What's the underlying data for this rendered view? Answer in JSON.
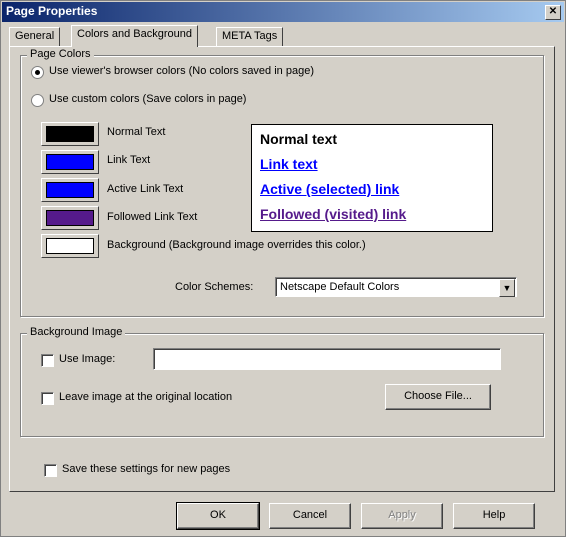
{
  "window": {
    "title": "Page Properties",
    "close_glyph": "✕"
  },
  "tabs": [
    {
      "label": "General"
    },
    {
      "label": "Colors and Background"
    },
    {
      "label": "META Tags"
    }
  ],
  "page_colors": {
    "legend": "Page Colors",
    "radio_browser": "Use viewer's browser colors (No colors saved in page)",
    "radio_custom": "Use custom colors (Save colors in page)",
    "rows": [
      {
        "label": "Normal Text",
        "color": "#000000"
      },
      {
        "label": "Link Text",
        "color": "#0000ff"
      },
      {
        "label": "Active Link Text",
        "color": "#0000ff"
      },
      {
        "label": "Followed Link Text",
        "color": "#551a8b"
      },
      {
        "label": "Background (Background image overrides this color.)",
        "color": "#ffffff"
      }
    ],
    "preview": {
      "normal": "Normal text",
      "link": "Link text",
      "active": "Active (selected) link",
      "followed": "Followed (visited) link"
    },
    "schemes_label": "Color Schemes:",
    "schemes_value": "Netscape Default Colors"
  },
  "bg_image": {
    "legend": "Background Image",
    "use_image": "Use Image:",
    "leave_image": "Leave image at the original location",
    "choose_file": "Choose File..."
  },
  "save_settings": "Save these settings for new pages",
  "buttons": {
    "ok": "OK",
    "cancel": "Cancel",
    "apply": "Apply",
    "help": "Help"
  },
  "colors": {
    "link": "#0000ff",
    "followed": "#551a8b",
    "title_bar": "#0a246a",
    "face": "#d4d0c8"
  }
}
